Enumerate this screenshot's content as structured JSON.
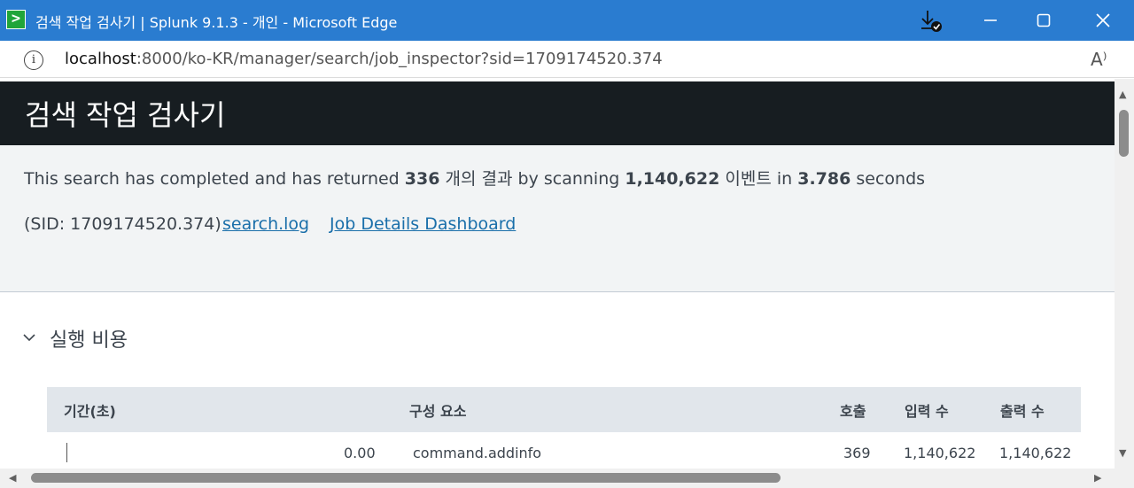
{
  "window": {
    "title": "검색 작업 검사기 | Splunk 9.1.3 - 개인 - Microsoft Edge",
    "app_icon_glyph": ">",
    "accent": "#2a7cd0"
  },
  "address_bar": {
    "host": "localhost",
    "path": ":8000/ko-KR/manager/search/job_inspector?sid=1709174520.374",
    "read_aloud_glyph": "A⁾"
  },
  "page": {
    "title": "검색 작업 검사기",
    "summary": {
      "part1": "This search has completed and has returned ",
      "result_count": "336",
      "part2": " 개의 결과 by scanning ",
      "event_count": "1,140,622",
      "part3": " 이벤트 in ",
      "duration": "3.786",
      "part4": " seconds"
    },
    "sid_text": "(SID: 1709174520.374)",
    "links": {
      "search_log": "search.log",
      "job_details": "Job Details Dashboard"
    },
    "section": {
      "toggle_glyph": "⌄",
      "title": "실행 비용"
    },
    "table": {
      "headers": {
        "duration": "기간(초)",
        "component": "구성 요소",
        "calls": "호출",
        "input_count": "입력 수",
        "output_count": "출력 수"
      },
      "rows": [
        {
          "duration": "0.00",
          "component": "command.addinfo",
          "calls": "369",
          "input_count": "1,140,622",
          "output_count": "1,140,622"
        }
      ]
    }
  }
}
